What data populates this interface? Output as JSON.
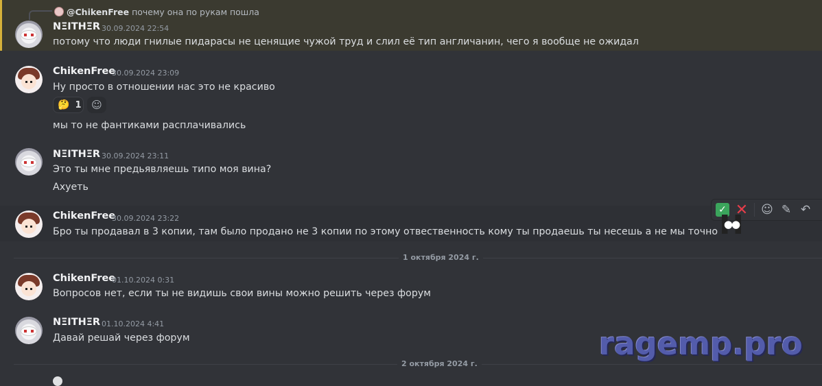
{
  "reply": {
    "username": "@ChikenFree",
    "text": "почему она по рукам пошла"
  },
  "messages": [
    {
      "user": "NΞITHΞR",
      "time": "30.09.2024 22:54",
      "lines": [
        "потому что люди гнилые пидарасы не ценящие чужой труд и слил её тип англичанин, чего я вообще не ожидал"
      ]
    },
    {
      "user": "ChikenFree",
      "time": "30.09.2024 23:09",
      "lines": [
        "Ну просто в отношении нас это не красиво",
        "мы то не фантиками расплачивались"
      ],
      "reaction": {
        "emoji": "🤔",
        "count": "1"
      }
    },
    {
      "user": "NΞITHΞR",
      "time": "30.09.2024 23:11",
      "lines": [
        "Это ты мне предьявляешь типо моя вина?",
        "Ахуеть"
      ]
    },
    {
      "user": "ChikenFree",
      "time": "30.09.2024 23:22",
      "lines": [
        "Бро ты продавал в 3 копии, там было продано не 3 копии по этому отвественность кому ты продаешь ты несешь а не мы точно"
      ]
    },
    {
      "user": "ChikenFree",
      "time": "01.10.2024 0:31",
      "lines": [
        "Вопросов нет, если ты не видишь свои вины можно решить через форум"
      ]
    },
    {
      "user": "NΞITHΞR",
      "time": "01.10.2024 4:41",
      "lines": [
        "Давай решай через форум"
      ]
    }
  ],
  "dividers": [
    "1 октября 2024 г.",
    "2 октября 2024 г."
  ],
  "toolbar": {
    "icons": [
      "check-reaction",
      "eyes-reaction",
      "cross-reaction",
      "add-reaction",
      "edit",
      "reply"
    ]
  },
  "watermark": "ragemp.pro",
  "colors": {
    "background": "#313338",
    "mention_highlight": "#3b3a30",
    "mention_bar": "#d6b13a",
    "username": "#f2f3f5",
    "timestamp": "#949ba4"
  }
}
